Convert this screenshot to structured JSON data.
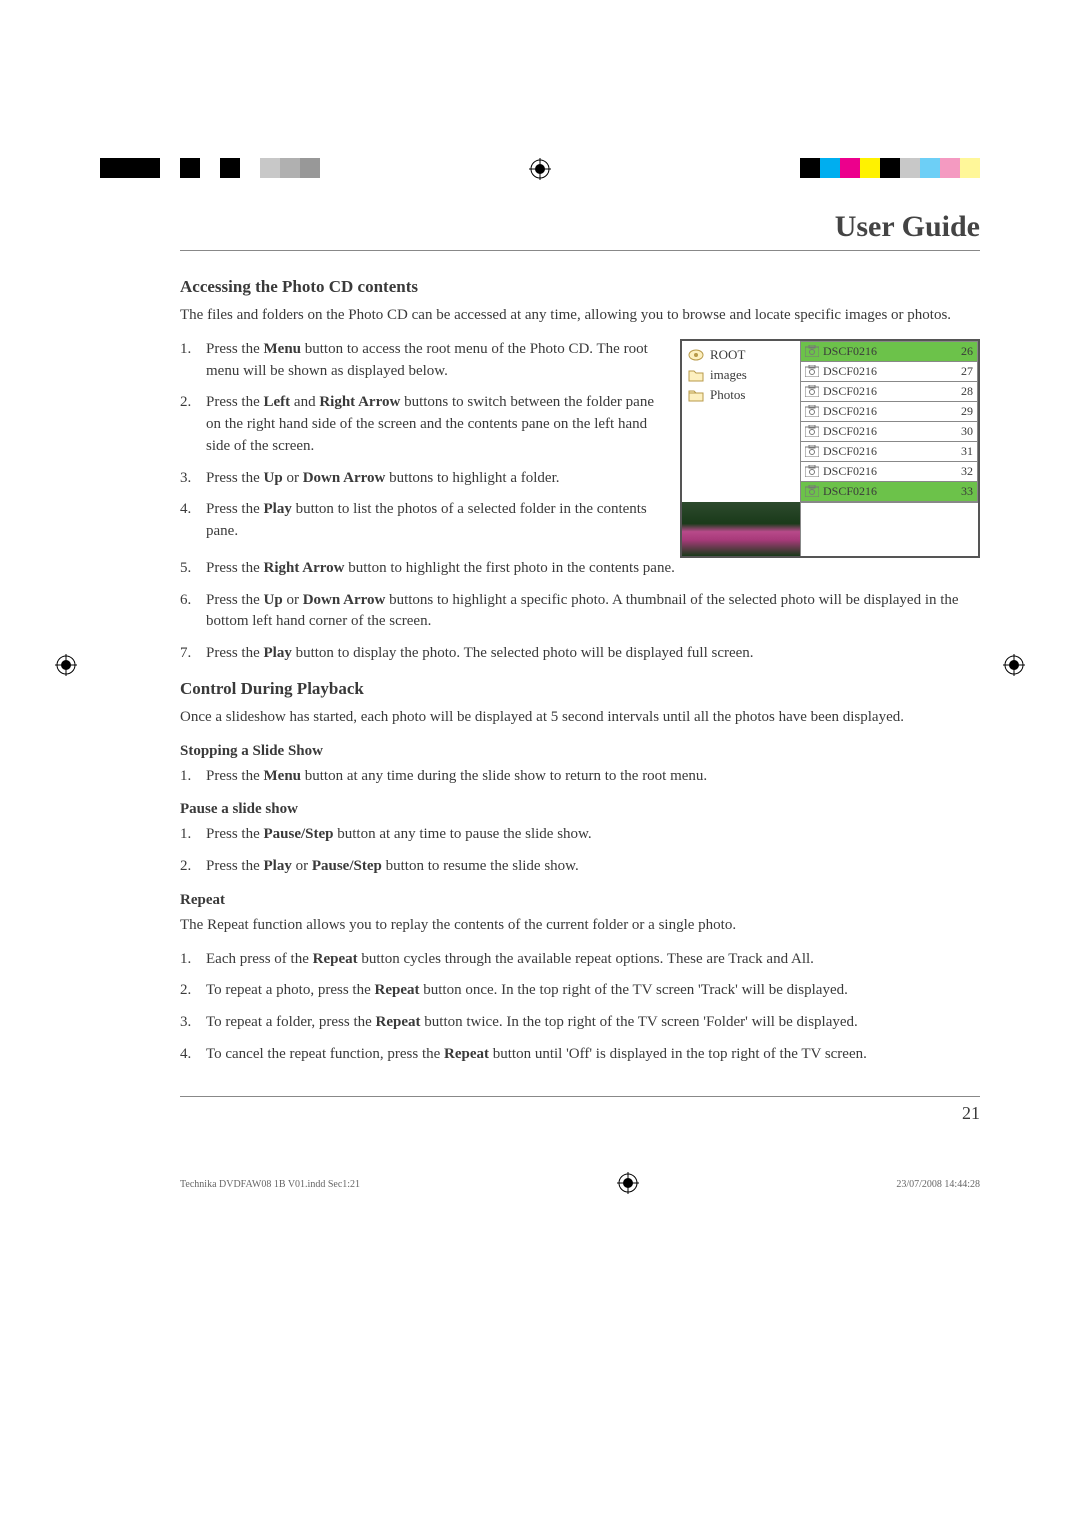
{
  "header": {
    "title": "User Guide"
  },
  "section1": {
    "heading": "Accessing the Photo CD contents",
    "intro": "The files and folders on the Photo CD can be accessed at any time, allowing you to browse and locate specific images or photos."
  },
  "steps1": [
    {
      "pre": "Press the ",
      "b1": "Menu",
      "post": " button to access the root menu of the Photo CD. The root menu will be shown as displayed below."
    },
    {
      "pre": "Press the ",
      "b1": "Left",
      "mid": " and ",
      "b2": "Right Arrow",
      "post": " buttons to switch between the folder pane on the right hand side of the screen and the contents pane on the left hand side of the screen."
    },
    {
      "pre": "Press the ",
      "b1": "Up",
      "mid": " or ",
      "b2": "Down Arrow",
      "post": " buttons to highlight a folder."
    },
    {
      "pre": "Press the ",
      "b1": "Play",
      "post": " button to list the photos of a selected folder in the contents pane."
    },
    {
      "pre": "Press the ",
      "b1": "Right Arrow",
      "post": " button to highlight the first photo in the contents pane."
    },
    {
      "pre": "Press the ",
      "b1": "Up",
      "mid": " or ",
      "b2": "Down Arrow",
      "post": " buttons to highlight a specific photo. A thumbnail of the selected photo will be displayed in the bottom left hand corner of the screen."
    },
    {
      "pre": "Press the ",
      "b1": "Play",
      "post": " button to display the photo. The selected photo will be displayed full screen."
    }
  ],
  "ui": {
    "folders": [
      "ROOT",
      "images",
      "Photos"
    ],
    "files": [
      {
        "name": "DSCF0216",
        "num": "26"
      },
      {
        "name": "DSCF0216",
        "num": "27"
      },
      {
        "name": "DSCF0216",
        "num": "28"
      },
      {
        "name": "DSCF0216",
        "num": "29"
      },
      {
        "name": "DSCF0216",
        "num": "30"
      },
      {
        "name": "DSCF0216",
        "num": "31"
      },
      {
        "name": "DSCF0216",
        "num": "32"
      },
      {
        "name": "DSCF0216",
        "num": "33"
      }
    ]
  },
  "section2": {
    "heading": "Control During Playback",
    "intro": "Once a slideshow has started, each photo will be displayed at 5 second intervals until all the photos have been displayed."
  },
  "sub1": {
    "heading": "Stopping a Slide Show"
  },
  "steps2": [
    {
      "pre": "Press the ",
      "b1": "Menu",
      "post": " button at any time during the slide show to return to the root menu."
    }
  ],
  "sub2": {
    "heading": "Pause a slide show"
  },
  "steps3": [
    {
      "pre": "Press the ",
      "b1": "Pause/Step",
      "post": " button at any time to pause the slide show."
    },
    {
      "pre": "Press the ",
      "b1": "Play",
      "mid": " or ",
      "b2": "Pause/Step",
      "post": " button to resume the slide show."
    }
  ],
  "sub3": {
    "heading": "Repeat",
    "intro": "The Repeat function allows you to replay the contents of the current folder or a single photo."
  },
  "steps4": [
    {
      "pre": "Each press of the ",
      "b1": "Repeat",
      "post": " button cycles through the available repeat options. These are Track and All."
    },
    {
      "pre": "To repeat a photo, press the ",
      "b1": "Repeat",
      "post": " button once. In the top right of the TV screen 'Track' will be displayed."
    },
    {
      "pre": "To repeat a folder, press the ",
      "b1": "Repeat",
      "post": " button twice. In the top right of the TV screen 'Folder' will be displayed."
    },
    {
      "pre": "To cancel the repeat function, press the ",
      "b1": "Repeat",
      "post": " button until 'Off' is displayed in the top right of the TV screen."
    }
  ],
  "pageNumber": "21",
  "footer": {
    "left": "Technika DVDFAW08 1B V01.indd   Sec1:21",
    "right": "23/07/2008   14:44:28"
  },
  "colors": {
    "leftBar": [
      "#000",
      "#000",
      "#000",
      "#fff",
      "#000",
      "#fff",
      "#000",
      "#fff",
      "#c8c8c8",
      "#b0b0b0",
      "#989898",
      "#fff",
      "#fff"
    ],
    "rightBar": [
      "#000",
      "#00aeef",
      "#ec008c",
      "#fff200",
      "#000",
      "#c8c8c8",
      "#6dcff6",
      "#f49ac1",
      "#fff799"
    ]
  }
}
